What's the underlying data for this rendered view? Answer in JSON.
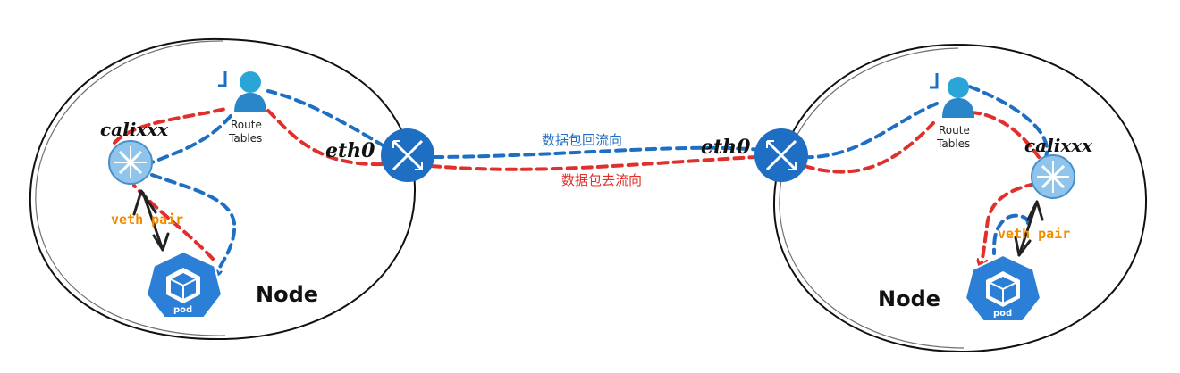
{
  "colors": {
    "out_flow": "#e0302c",
    "return_flow": "#1e6fc4",
    "veth": "#f08c00",
    "router": "#8fc4ec",
    "switch": "#1e6fc4",
    "pod": "#2b7fd6",
    "person": "#2aa5d8"
  },
  "flows": {
    "return_label": "数据包回流向",
    "out_label": "数据包去流向"
  },
  "left_node": {
    "title": "Node",
    "route_table_line1": "Route",
    "route_table_line2": "Tables",
    "cali_label": "calixxx",
    "veth_label": "veth pair",
    "eth_label": "eth0",
    "pod_label": "pod"
  },
  "right_node": {
    "title": "Node",
    "route_table_line1": "Route",
    "route_table_line2": "Tables",
    "cali_label": "calixxx",
    "veth_label": "veth pair",
    "eth_label": "eth0",
    "pod_label": "pod"
  },
  "icons": {
    "route_table": "person-icon",
    "router": "router-icon",
    "switch": "switch-icon",
    "pod": "pod-cube-icon"
  }
}
